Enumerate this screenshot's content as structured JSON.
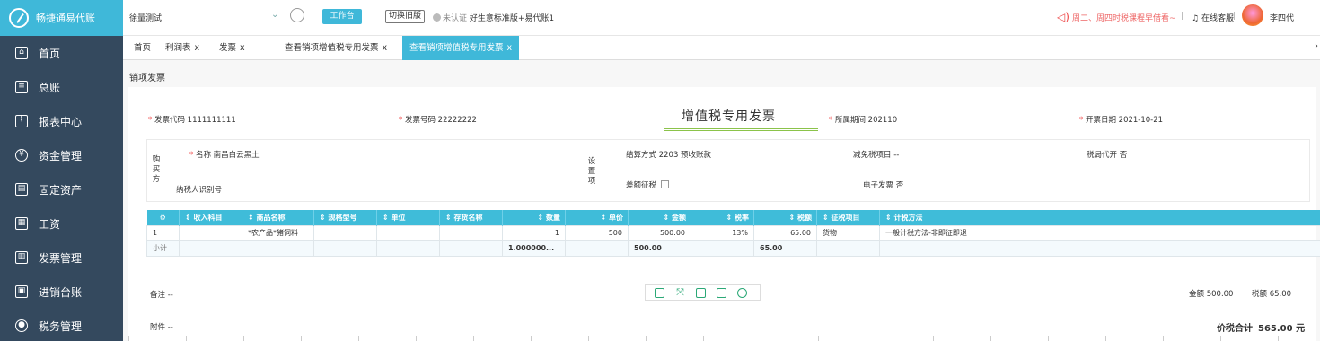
{
  "app": {
    "title": "畅捷通易代账"
  },
  "sidebar": {
    "items": [
      {
        "label": "首页",
        "icon": "home-icon"
      },
      {
        "label": "总账",
        "icon": "ledger-icon"
      },
      {
        "label": "报表中心",
        "icon": "chart-icon"
      },
      {
        "label": "资金管理",
        "icon": "money-icon"
      },
      {
        "label": "固定资产",
        "icon": "asset-icon"
      },
      {
        "label": "工资",
        "icon": "salary-icon"
      },
      {
        "label": "发票管理",
        "icon": "invoice-icon"
      },
      {
        "label": "进销台账",
        "icon": "account-book-icon"
      },
      {
        "label": "税务管理",
        "icon": "tax-icon"
      }
    ]
  },
  "topbar": {
    "company": "徐量测试",
    "workbench": "工作台",
    "switch_old": "切换旧版",
    "cert_status": "未认证",
    "edition": "好生意标准版+易代账1",
    "notice": "周二、周四时税课程早借看~",
    "customer_service": "在线客服",
    "user": "李四代"
  },
  "tabs": [
    {
      "label": "首页"
    },
    {
      "label": "利润表"
    },
    {
      "label": "发票"
    },
    {
      "label": "查看销项增值税专用发票"
    },
    {
      "label": "查看销项增值税专用发票"
    }
  ],
  "page": {
    "title": "销项发票"
  },
  "invoice": {
    "code_label": "发票代码",
    "code": "1111111111",
    "number_label": "发票号码",
    "number": "22222222",
    "title": "增值税专用发票",
    "period_label": "所属期间",
    "period": "202110",
    "date_label": "开票日期",
    "date": "2021-10-21",
    "buyer_side_label": "购买方",
    "buyer_name_label": "名称",
    "buyer_name": "南昌白云黑土",
    "taxpayer_id_label": "纳税人识别号",
    "settings_side_label": "设置项",
    "settlement_label": "结算方式",
    "settlement": "2203 预收账款",
    "diff_tax_label": "差额征税",
    "exempt_label": "减免税项目",
    "exempt": "--",
    "tax_agency_label": "税局代开",
    "tax_agency": "否",
    "e_invoice_label": "电子发票",
    "e_invoice": "否"
  },
  "table": {
    "headers": [
      "",
      "收入科目",
      "商品名称",
      "规格型号",
      "单位",
      "存货名称",
      "数量",
      "单价",
      "金额",
      "税率",
      "税额",
      "征税项目",
      "计税方法"
    ],
    "rows": [
      [
        "1",
        "",
        "*农产品*猪饲料",
        "",
        "",
        "",
        "1",
        "500",
        "500.00",
        "13%",
        "65.00",
        "货物",
        "一般计税方法-非即征即退"
      ]
    ],
    "subtotal": {
      "label": "小计",
      "qty": "1.000000...",
      "amount": "500.00",
      "tax": "65.00"
    }
  },
  "footer": {
    "remark_label": "备注",
    "remark": "--",
    "attach_label": "附件",
    "attach": "--",
    "amount_label": "金额",
    "amount": "500.00",
    "tax_label": "税额",
    "tax": "65.00",
    "total_label": "价税合计",
    "total": "565.00 元"
  }
}
